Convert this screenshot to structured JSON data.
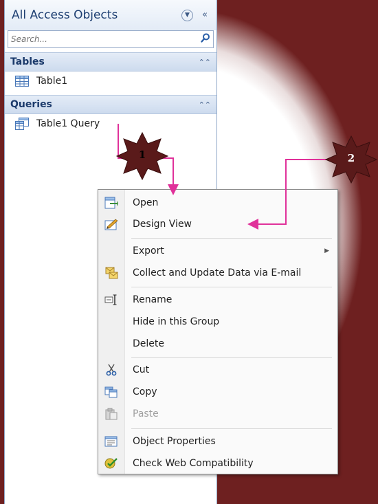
{
  "nav_pane": {
    "title": "All Access Objects",
    "search_placeholder": "Search...",
    "groups": [
      {
        "label": "Tables",
        "items": [
          {
            "label": "Table1",
            "icon": "table-icon"
          }
        ]
      },
      {
        "label": "Queries",
        "items": [
          {
            "label": "Table1 Query",
            "icon": "query-icon"
          }
        ]
      }
    ]
  },
  "context_menu": {
    "items": [
      {
        "label": "Open",
        "icon": "open-icon"
      },
      {
        "label": "Design View",
        "icon": "design-view-icon"
      },
      {
        "label": "Export",
        "has_submenu": true
      },
      {
        "label": "Collect and Update Data via E-mail",
        "icon": "collect-data-icon"
      },
      {
        "label": "Rename",
        "icon": "rename-icon"
      },
      {
        "label": "Hide in this Group"
      },
      {
        "label": "Delete"
      },
      {
        "label": "Cut",
        "icon": "cut-icon"
      },
      {
        "label": "Copy",
        "icon": "copy-icon"
      },
      {
        "label": "Paste",
        "icon": "paste-icon",
        "disabled": true
      },
      {
        "label": "Object Properties",
        "icon": "properties-icon"
      },
      {
        "label": "Check Web Compatibility",
        "icon": "web-compat-icon"
      }
    ]
  },
  "callouts": [
    {
      "label": "1"
    },
    {
      "label": "2"
    }
  ],
  "colors": {
    "background": "#6e2020",
    "callout_star": "#5a1a1a",
    "arrow": "#e0319a"
  }
}
